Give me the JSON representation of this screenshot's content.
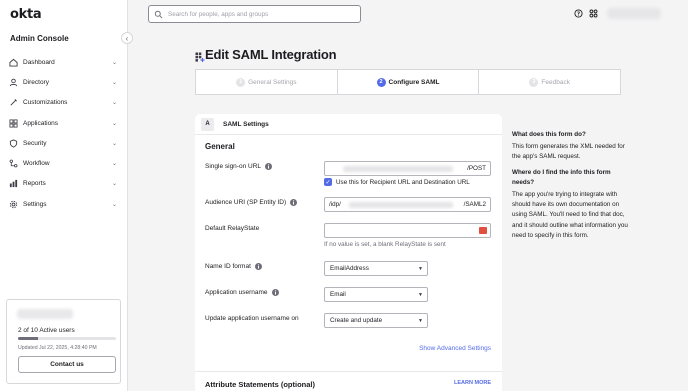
{
  "app": {
    "logo": "okta",
    "console_title": "Admin Console"
  },
  "sidebar": {
    "collapse_icon": "chevron-left-icon",
    "items": [
      {
        "label": "Dashboard",
        "icon": "dashboard-icon"
      },
      {
        "label": "Directory",
        "icon": "directory-icon"
      },
      {
        "label": "Customizations",
        "icon": "customizations-icon"
      },
      {
        "label": "Applications",
        "icon": "applications-icon"
      },
      {
        "label": "Security",
        "icon": "shield-icon"
      },
      {
        "label": "Workflow",
        "icon": "workflow-icon"
      },
      {
        "label": "Reports",
        "icon": "reports-icon"
      },
      {
        "label": "Settings",
        "icon": "gear-icon"
      }
    ],
    "license": {
      "users_text": "2 of 10 Active users",
      "users_fraction": 0.2,
      "updated": "Updated Jul 22, 2025, 4:28:40 PM",
      "contact_label": "Contact us"
    }
  },
  "topbar": {
    "search_placeholder": "Search for people, apps and groups"
  },
  "page": {
    "title": "Edit SAML Integration",
    "steps": [
      {
        "num": "1",
        "label": "General Settings",
        "active": false
      },
      {
        "num": "2",
        "label": "Configure SAML",
        "active": true
      },
      {
        "num": "3",
        "label": "Feedback",
        "active": false
      }
    ]
  },
  "form": {
    "section_letter": "A",
    "section_title": "SAML Settings",
    "group_title": "General",
    "sso_url": {
      "label": "Single sign-on URL",
      "suffix": "/POST"
    },
    "recipient_checkbox": {
      "label": "Use this for Recipient URL and Destination URL",
      "checked": true
    },
    "audience_uri": {
      "label": "Audience URI (SP Entity ID)",
      "prefix": "/idp/",
      "suffix": "/SAML2"
    },
    "relay_state": {
      "label": "Default RelayState",
      "help": "If no value is set, a blank RelayState is sent"
    },
    "name_id_format": {
      "label": "Name ID format",
      "value": "EmailAddress"
    },
    "app_username": {
      "label": "Application username",
      "value": "Email"
    },
    "update_username": {
      "label": "Update application username on",
      "value": "Create and update"
    },
    "advanced_link": "Show Advanced Settings",
    "attribute_title": "Attribute Statements (optional)",
    "learn_more": "LEARN MORE"
  },
  "help_panel": {
    "q1": "What does this form do?",
    "a1": "This form generates the XML needed for the app's SAML request.",
    "q2": "Where do I find the info this form needs?",
    "a2": "The app you're trying to integrate with should have its own documentation on using SAML. You'll need to find that doc, and it should outline what information you need to specify in this form."
  },
  "colors": {
    "accent": "#546be7",
    "text": "#1d1d21",
    "muted": "#6e6e78",
    "background": "#f4f4f4"
  }
}
